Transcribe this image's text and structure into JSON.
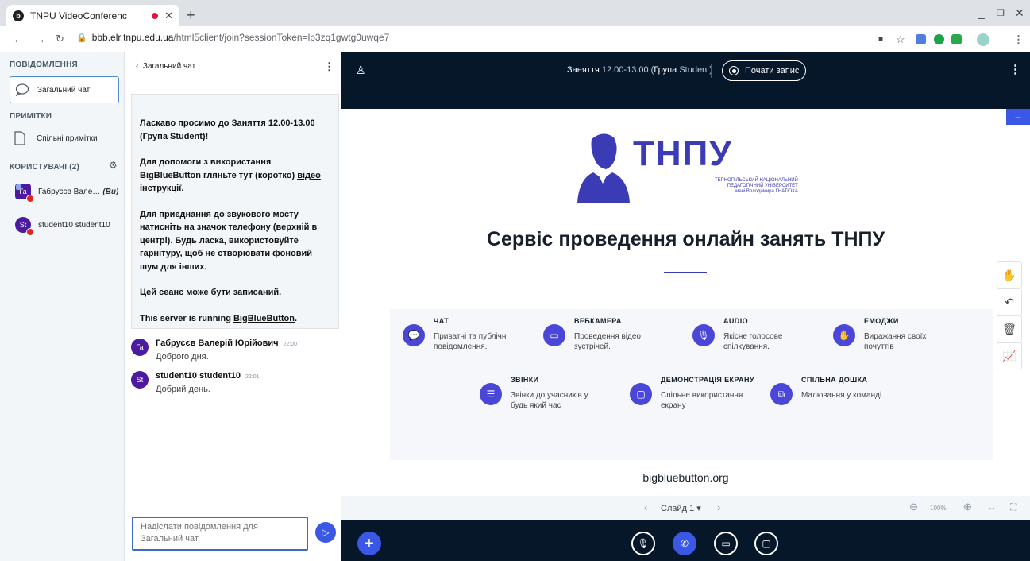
{
  "browser": {
    "tab_title": "TNPU VideoConferenc",
    "tab_favicon": "b",
    "url_host": "bbb.elr.tnpu.edu.ua",
    "url_path": "/html5client/join?sessionToken=lp3zq1gwtg0uwqe7"
  },
  "sidebar": {
    "messages_title": "ПОВІДОМЛЕННЯ",
    "public_chat": "Загальний чат",
    "notes_title": "ПРИМІТКИ",
    "shared_notes": "Спільні примітки",
    "users_title": "КОРИСТУВАЧІ (2)",
    "users": [
      {
        "initials": "Га",
        "name": "Габрусєв Вале…",
        "role": "(Ви)"
      },
      {
        "initials": "St",
        "name": "student10 student10",
        "role": ""
      }
    ]
  },
  "chat": {
    "back_label": "Загальний чат",
    "welcome": {
      "p1": "Ласкаво просимо до Заняття 12.00-13.00 (Група Student)!",
      "p2_pre": "Для допомоги з використання BigBlueButton гляньте тут (коротко) ",
      "p2_link": "відео інструкції",
      "p2_post": ".",
      "p3": "Для приєднання до звукового мосту натисніть на значок телефону (верхній в центрі). Будь ласка, використовуйте гарнітуру, щоб не створювати фоновий шум для інших.",
      "p4": "Цей сеанс може бути записаний.",
      "p5_pre": "This server is running ",
      "p5_link": "BigBlueButton",
      "p5_post": "."
    },
    "messages": [
      {
        "initials": "Га",
        "name": "Габрусєв Валерій Юрійович",
        "time": "22:00",
        "text": "Доброго дня."
      },
      {
        "initials": "St",
        "name": "student10 student10",
        "time": "22:01",
        "text": "Добрий день."
      }
    ],
    "input_placeholder": "Надіслати повідомлення для Загальний чат"
  },
  "main": {
    "meeting_name": "Заняття",
    "meeting_time": "12.00-13.00 (",
    "group_label": "Група",
    "group_value": "Student)",
    "record_label": "Почати запис",
    "slide": {
      "logo_text": "ТНПУ",
      "logo_sub1": "ТЕРНОПІЛЬСЬКИЙ НАЦІОНАЛЬНИЙ",
      "logo_sub2": "ПЕДАГОГІЧНИЙ УНІВЕРСИТЕТ",
      "logo_sub3": "імені Володимира ГНАТЮКА",
      "headline": "Сервіс проведення онлайн занять ТНПУ",
      "features": [
        {
          "title": "ЧАТ",
          "desc": "Приватні та публічні повідомлення.",
          "icon": "chat-icon"
        },
        {
          "title": "ВЕБКАМЕРА",
          "desc": "Проведення відео зустрічей.",
          "icon": "camera-icon"
        },
        {
          "title": "AUDIO",
          "desc": "Якісне голосове спілкування.",
          "icon": "mic-icon"
        },
        {
          "title": "ЕМОДЖИ",
          "desc": "Виражання своїх почуттів",
          "icon": "hand-icon"
        },
        {
          "title": "ЗВІНКИ",
          "desc": "Звінки до учасників у будь який час",
          "icon": "poll-icon"
        },
        {
          "title": "ДЕМОНСТРАЦІЯ ЕКРАНУ",
          "desc": "Спільне використання екрану",
          "icon": "screen-icon"
        },
        {
          "title": "СПІЛЬНА ДОШКА",
          "desc": "Малювання у команді",
          "icon": "whiteboard-icon"
        }
      ],
      "site": "bigbluebutton.org"
    },
    "slide_label": "Слайд 1",
    "zoom": "100%"
  }
}
